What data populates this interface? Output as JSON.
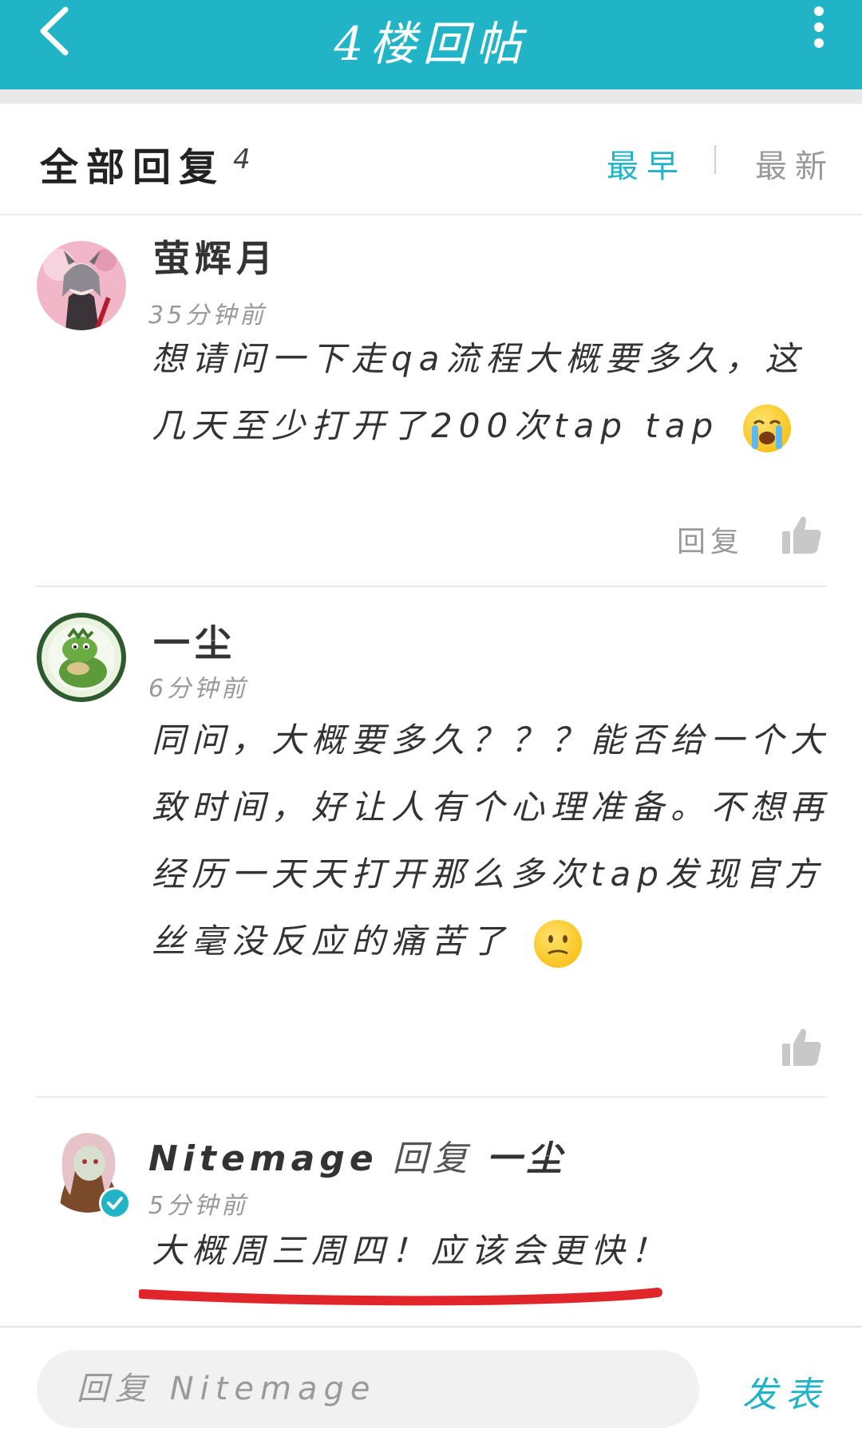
{
  "topbar": {
    "title": "4楼回帖",
    "icons": {
      "back": "chevron-left-icon",
      "more": "more-vertical-icon"
    }
  },
  "header": {
    "title": "全部回复",
    "count": "4",
    "sort_early": "最早",
    "sort_new": "最新"
  },
  "comments": [
    {
      "name": "萤辉月",
      "time": "35分钟前",
      "content": "想请问一下走qa流程大概要多久，这几天至少打开了200次tap tap",
      "emoji": "loudly-crying-face",
      "reply_label": "回复"
    },
    {
      "name": "一尘",
      "time": "6分钟前",
      "content": "同问，大概要多久？？？能否给一个大致时间，好让人有个心理准备。不想再经历一天天打开那么多次tap发现官方丝毫没反应的痛苦了",
      "emoji": "confused-face"
    },
    {
      "name": "Nitemage",
      "reply_word": "回复",
      "reply_target": "一尘",
      "time": "5分钟前",
      "content": "大概周三周四！应该会更快！"
    }
  ],
  "bottom": {
    "input_placeholder": "回复 Nitemage",
    "send_label": "发表"
  },
  "colors": {
    "accent": "#20b4c6",
    "underline": "#e0262b"
  }
}
